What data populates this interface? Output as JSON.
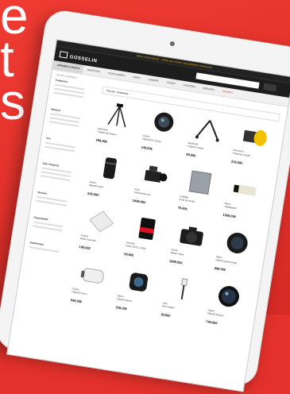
{
  "headline": {
    "line1": "e",
    "line2": "t",
    "line3": "s"
  },
  "site": {
    "promo": "NEW CATALOGUE · FREE DELIVERY ON ORDERS OVER £50",
    "logo": "GOSSELIN",
    "nav": [
      "APPAREILS PHOTO",
      "OBJECTIFS",
      "ACCESSOIRES",
      "VIDEO",
      "LUMIÈRE",
      "STUDIO",
      "LOCATION",
      "SERVICES",
      "PROMOS"
    ],
    "crumb": "Accueil › Catalogue",
    "sort": "Trier par : Pertinence",
    "sidebar": [
      "Catégories",
      "Marques",
      "Prix",
      "Type d'objectif",
      "Monture",
      "Disponibilité",
      "Stabilisation"
    ],
    "products": [
      {
        "brand": "Manfrotto",
        "name": "Trépied aluminium",
        "price": "299,99€"
      },
      {
        "brand": "Canon",
        "name": "Objectif EF 50mm",
        "price": "149,00€"
      },
      {
        "brand": "Manfrotto",
        "name": "Support roulant",
        "price": "89,90€"
      },
      {
        "brand": "Elinchrom",
        "name": "Projecteur studio",
        "price": "219,00€"
      },
      {
        "brand": "Canon",
        "name": "Objectif zoom",
        "price": "529,00€"
      },
      {
        "brand": "Sony",
        "name": "Caméscope pro",
        "price": "2499,00€"
      },
      {
        "brand": "Lastolite",
        "name": "Fond de studio",
        "price": "79,00€"
      },
      {
        "brand": "Nikon",
        "name": "Téléobjectif",
        "price": "1299,00€"
      },
      {
        "brand": "Profoto",
        "name": "Boîte à lumière",
        "price": "199,00€"
      },
      {
        "brand": "SanDisk",
        "name": "Carte SDXC 128Go",
        "price": "59,90€"
      },
      {
        "brand": "Canon",
        "name": "Boîtier reflex",
        "price": "1899,00€"
      },
      {
        "brand": "Nikon",
        "name": "Objectif grand angle",
        "price": "899,00€"
      },
      {
        "brand": "Canon",
        "name": "Objectif macro",
        "price": "649,00€"
      },
      {
        "brand": "Nikon",
        "name": "Objectif 35mm",
        "price": "229,00€"
      },
      {
        "brand": "Joby",
        "name": "Mini trépied",
        "price": "39,90€"
      },
      {
        "brand": "Sigma",
        "name": "Objectif fisheye",
        "price": "749,00€"
      }
    ]
  }
}
